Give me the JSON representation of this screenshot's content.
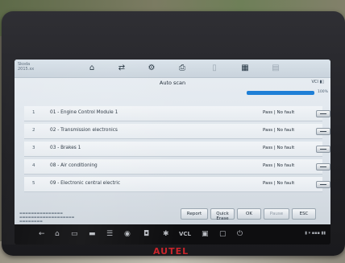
{
  "vehicle": {
    "line1": "Skoda",
    "line2": "2015.xx"
  },
  "toolbar": {
    "icons": [
      "home-icon",
      "vehicle-swap-icon",
      "settings-icon",
      "print-icon",
      "help-icon",
      "calendar-icon",
      "data-logging-icon"
    ]
  },
  "screen_title": "Auto scan",
  "vci_status": "VCI",
  "progress": {
    "value": 1.0,
    "label": "100%"
  },
  "modules": [
    {
      "num": "1",
      "name": "01 - Engine Control Module 1",
      "status": "Pass | No fault"
    },
    {
      "num": "2",
      "name": "02 - Transmission electronics",
      "status": "Pass | No fault"
    },
    {
      "num": "3",
      "name": "03 - Brakes 1",
      "status": "Pass | No fault"
    },
    {
      "num": "4",
      "name": "08 - Air conditioning",
      "status": "Pass | No fault"
    },
    {
      "num": "5",
      "name": "09 - Electronic central electric",
      "status": "Pass | No fault"
    }
  ],
  "footer_buttons": {
    "report": "Report",
    "quick_clear": "Quick Erase",
    "ok": "OK",
    "pause": "Pause",
    "esc": "ESC"
  },
  "navbar": {
    "vcl_label": "VCL"
  },
  "brand": {
    "logo": "AUTEL",
    "color": "#c9242b"
  }
}
